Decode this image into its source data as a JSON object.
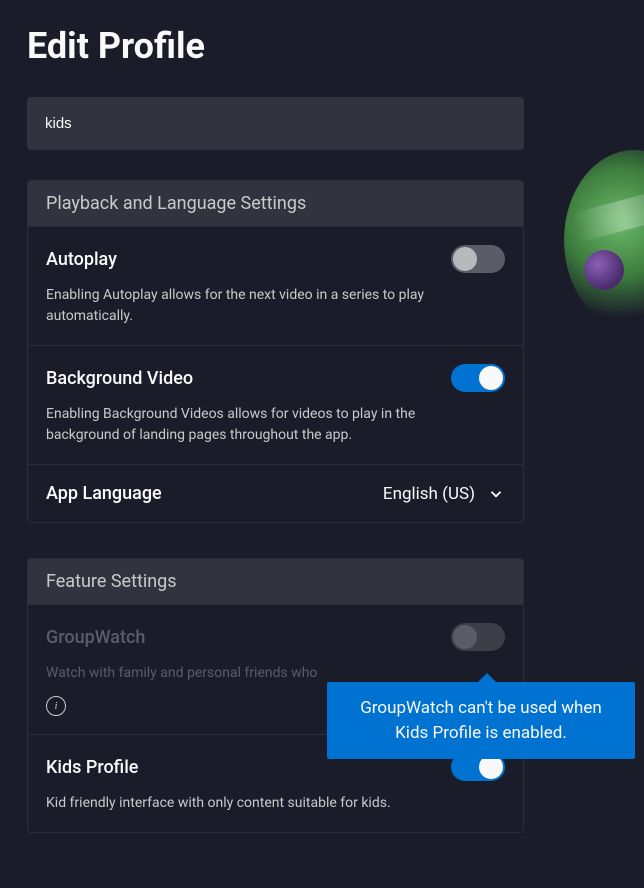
{
  "page": {
    "title": "Edit Profile"
  },
  "profile": {
    "name": "kids"
  },
  "sections": {
    "playback": {
      "header": "Playback and Language Settings",
      "autoplay": {
        "label": "Autoplay",
        "desc": "Enabling Autoplay allows for the next video in a series to play automatically.",
        "on": false
      },
      "backgroundVideo": {
        "label": "Background Video",
        "desc": "Enabling Background Videos allows for videos to play in the background of landing pages throughout the app.",
        "on": true
      },
      "appLanguage": {
        "label": "App Language",
        "value": "English (US)"
      }
    },
    "features": {
      "header": "Feature Settings",
      "groupWatch": {
        "label": "GroupWatch",
        "desc": "Watch with family and personal friends who",
        "on": false,
        "disabled": true
      },
      "kidsProfile": {
        "label": "Kids Profile",
        "desc": "Kid friendly interface with only content suitable for kids.",
        "on": true
      }
    }
  },
  "tooltip": {
    "text": "GroupWatch can't be used when Kids Profile is enabled."
  }
}
